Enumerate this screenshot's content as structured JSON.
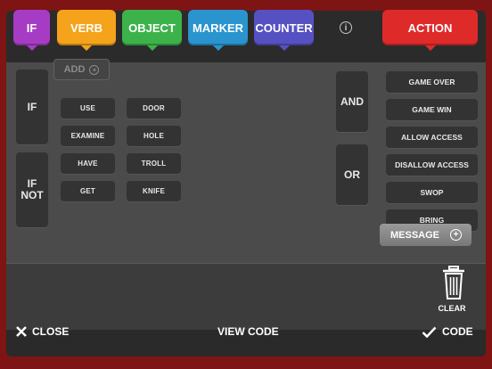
{
  "tabs": [
    {
      "label": "IF",
      "color": "#a63cc4"
    },
    {
      "label": "VERB",
      "color": "#f5a31a"
    },
    {
      "label": "OBJECT",
      "color": "#3cb34a"
    },
    {
      "label": "MARKER",
      "color": "#2a94cf"
    },
    {
      "label": "COUNTER",
      "color": "#5651c2"
    },
    {
      "label": "ACTION",
      "color": "#df2a2a"
    }
  ],
  "conditions": {
    "if": "IF",
    "if_not": [
      "IF",
      "NOT"
    ]
  },
  "add_label": "ADD",
  "verbs": [
    "USE",
    "EXAMINE",
    "HAVE",
    "GET"
  ],
  "objects": [
    "DOOR",
    "HOLE",
    "TROLL",
    "KNIFE"
  ],
  "logic": {
    "and": "AND",
    "or": "OR"
  },
  "actions": [
    "GAME OVER",
    "GAME WIN",
    "ALLOW ACCESS",
    "DISALLOW ACCESS",
    "SWOP",
    "BRING"
  ],
  "message_label": "MESSAGE",
  "clear_label": "CLEAR",
  "info_icon": "i",
  "bottom": {
    "close": "CLOSE",
    "view_code": "VIEW CODE",
    "code": "CODE"
  }
}
